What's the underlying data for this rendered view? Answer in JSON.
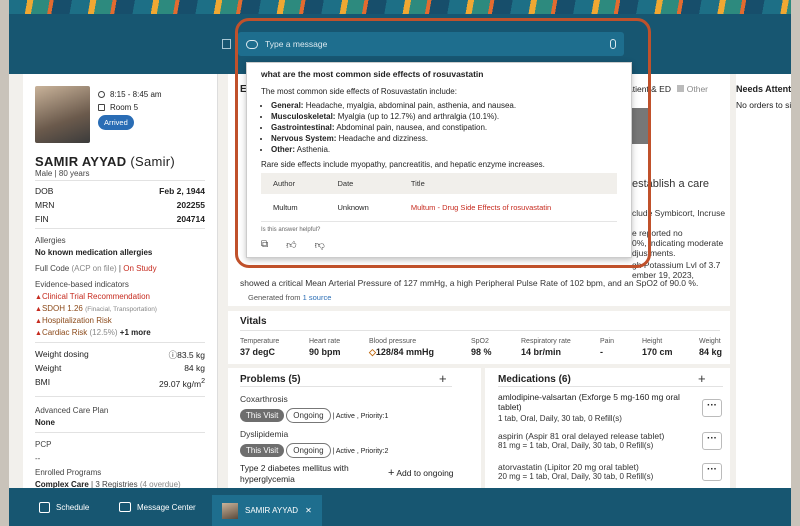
{
  "search": {
    "placeholder": "Type a message"
  },
  "patient": {
    "time": "8:15 - 8:45 am",
    "room": "Room 5",
    "status": "Arrived",
    "name": "SAMIR AYYAD",
    "nickname": "(Samir)",
    "sex_age": "Male  |  80 years",
    "dob_label": "DOB",
    "dob": "Feb 2, 1944",
    "mrn_label": "MRN",
    "mrn": "202255",
    "fin_label": "FIN",
    "fin": "204714",
    "allergies_label": "Allergies",
    "allergies": "No known medication allergies",
    "code_status": "Full Code",
    "code_note": "(ACP on file)",
    "study": "On Study",
    "ebi_label": "Evidence-based indicators",
    "ebi": [
      {
        "label": "Clinical Trial Recommendation",
        "note": ""
      },
      {
        "label": "SDOH 1.26",
        "note": "(Finacial, Transportation)"
      },
      {
        "label": "Hospitalization Risk",
        "note": ""
      },
      {
        "label": "Cardiac Risk",
        "note": "(12.5%)",
        "more": "+1 more"
      }
    ],
    "weight_dosing_label": "Weight dosing",
    "weight_dosing": "83.5 kg",
    "weight_label": "Weight",
    "weight": "84 kg",
    "bmi_label": "BMI",
    "bmi": "29.07 kg/m",
    "acp_label": "Advanced Care Plan",
    "acp": "None",
    "pcp_label": "PCP",
    "pcp": "--",
    "programs_label": "Enrolled Programs",
    "programs": "Complex Care",
    "programs_extra": "| 3 Registries",
    "programs_overdue": "(4 overdue)"
  },
  "background": {
    "tabs_right": "atient & ED",
    "other": "Other",
    "needs_attention": "Needs Attention",
    "no_orders": "No orders to sig",
    "frag_establish": "establish a care",
    "frag_symbicort": "clude Symbicort, Incruse",
    "frag_reported": "e reported no",
    "frag_moderate": "0%, indicating moderate",
    "frag_adjust": "djustments.",
    "frag_potassium": "gh Potassium Lvl of 3.7",
    "frag_2023": "ember 19, 2023,",
    "summary_line": "showed a critical Mean Arterial Pressure of 127 mmHg, a high Peripheral Pulse Rate of 102 bpm, and an SpO2 of 90.0 %.",
    "generated_prefix": "Generated from",
    "generated_link": "1 source"
  },
  "vitals": {
    "title": "Vitals",
    "items": [
      {
        "label": "Temperature",
        "value": "37 degC"
      },
      {
        "label": "Heart rate",
        "value": "90 bpm"
      },
      {
        "label": "Blood pressure",
        "value": "128/84 mmHg"
      },
      {
        "label": "SpO2",
        "value": "98 %"
      },
      {
        "label": "Respiratory rate",
        "value": "14 br/min"
      },
      {
        "label": "Pain",
        "value": "-"
      },
      {
        "label": "Height",
        "value": "170 cm"
      },
      {
        "label": "Weight",
        "value": "84 kg"
      }
    ]
  },
  "problems": {
    "title": "Problems (5)",
    "items": [
      {
        "name": "Coxarthrosis",
        "pill1": "This Visit",
        "pill2": "Ongoing",
        "meta": "| Active , Priority:1"
      },
      {
        "name": "Dyslipidemia",
        "pill1": "This Visit",
        "pill2": "Ongoing",
        "meta": "| Active , Priority:2"
      },
      {
        "name": "Type 2 diabetes mellitus with hyperglycemia",
        "action": "Add to ongoing"
      }
    ]
  },
  "medications": {
    "title": "Medications (6)",
    "items": [
      {
        "name": "amlodipine-valsartan (Exforge 5 mg-160 mg oral tablet)",
        "sig": "1 tab, Oral, Daily, 30 tab, 0 Refill(s)"
      },
      {
        "name": "aspirin (Aspir 81 oral delayed release tablet)",
        "sig": "81 mg = 1 tab, Oral, Daily, 30 tab, 0 Refill(s)"
      },
      {
        "name": "atorvastatin (Lipitor 20 mg oral tablet)",
        "sig": "20 mg = 1 tab, Oral, Daily, 30 tab, 0 Refill(s)"
      }
    ]
  },
  "popup": {
    "question": "what are the most common side effects of rosuvastatin",
    "intro": "The most common side effects of Rosuvastatin include:",
    "effects": [
      {
        "key": "General:",
        "text": " Headache, myalgia, abdominal pain, asthenia, and nausea."
      },
      {
        "key": "Musculoskeletal:",
        "text": " Myalgia (up to 12.7%) and arthralgia (10.1%)."
      },
      {
        "key": "Gastrointestinal:",
        "text": " Abdominal pain, nausea, and constipation."
      },
      {
        "key": "Nervous System:",
        "text": " Headache and dizziness."
      },
      {
        "key": "Other:",
        "text": " Asthenia."
      }
    ],
    "rare": "Rare side effects include myopathy, pancreatitis, and hepatic enzyme increases.",
    "table_headers": [
      "Author",
      "Date",
      "Title"
    ],
    "table_row": {
      "author": "Multum",
      "date": "Unknown",
      "title": "Multum - Drug Side Effects of rosuvastatin"
    },
    "feedback": "Is this answer helpful?"
  },
  "bottom": {
    "schedule": "Schedule",
    "message_center": "Message Center",
    "patient_tab": "SAMIR AYYAD"
  },
  "colors": {
    "topbar": "#175671",
    "highlight": "#c0512b",
    "alert_red": "#c62a1e"
  }
}
